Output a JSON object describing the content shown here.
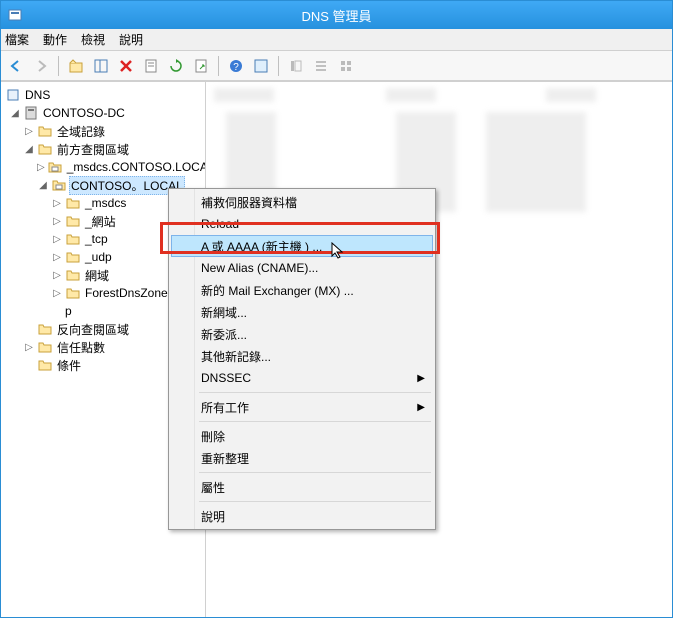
{
  "window": {
    "title": "DNS 管理員"
  },
  "menu": {
    "file": "檔案",
    "action": "動作",
    "view": "檢視",
    "help": "說明"
  },
  "tree": {
    "root": "DNS",
    "server": "CONTOSO-DC",
    "global": "全域記錄",
    "flz": "前方查閱區域",
    "zone_ms": "_msdcs.CONTOSO.LOCAL",
    "zone_sel": "CONTOSO。LOCAL",
    "sub": {
      "msdcs": "_msdcs",
      "sites": "_網站",
      "tcp": "_tcp",
      "udp": "_udp",
      "domain": "網域",
      "forest": "ForestDnsZones",
      "p": "p"
    },
    "rlz": "反向查閱區域",
    "trust": "信任點數",
    "cond": "條件"
  },
  "contextMenu": {
    "items": [
      {
        "label": "補救伺服器資料檔",
        "type": "item"
      },
      {
        "label": "Reload",
        "type": "item"
      },
      {
        "label": "A 或 AAAA (新主機 ) ...",
        "type": "item",
        "highlight": true
      },
      {
        "label": "New Alias (CNAME)...",
        "type": "item"
      },
      {
        "label": "新的 Mail Exchanger (MX) ...",
        "type": "item"
      },
      {
        "label": "新網域...",
        "type": "item"
      },
      {
        "label": "新委派...",
        "type": "item"
      },
      {
        "label": "其他新記錄...",
        "type": "item"
      },
      {
        "label": "DNSSEC",
        "type": "item",
        "submenu": true
      },
      {
        "type": "divider"
      },
      {
        "label": "所有工作",
        "type": "item",
        "submenu": true
      },
      {
        "type": "divider"
      },
      {
        "label": "刪除",
        "type": "item"
      },
      {
        "label": "重新整理",
        "type": "item"
      },
      {
        "type": "divider"
      },
      {
        "label": "屬性",
        "type": "item"
      },
      {
        "type": "divider"
      },
      {
        "label": "說明",
        "type": "item"
      }
    ]
  }
}
